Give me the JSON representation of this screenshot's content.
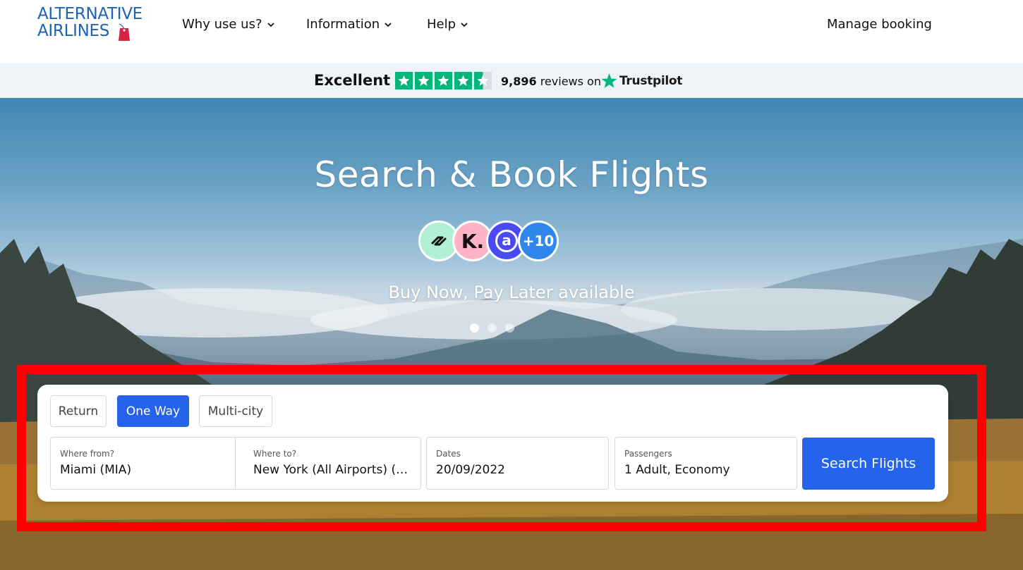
{
  "header": {
    "logo_line1": "ALTERNATIVE",
    "logo_line2": "AIRLINES",
    "nav": [
      {
        "label": "Why use us?"
      },
      {
        "label": "Information"
      },
      {
        "label": "Help"
      }
    ],
    "manage_booking": "Manage booking"
  },
  "trustpilot": {
    "rating_word": "Excellent",
    "stars": 4.5,
    "reviews_count": "9,896",
    "reviews_text": "reviews on",
    "brand": "Trustpilot",
    "star_color": "#00b67a"
  },
  "hero": {
    "title": "Search & Book Flights",
    "bnpl_more": "+10",
    "bnpl_klarna": "K.",
    "bnpl_atome": "a",
    "subtitle": "Buy Now, Pay Later available",
    "carousel_total": 3,
    "carousel_active": 1
  },
  "search": {
    "trip_types": [
      "Return",
      "One Way",
      "Multi-city"
    ],
    "active_trip": "One Way",
    "from": {
      "label": "Where from?",
      "value": "Miami (MIA)"
    },
    "to": {
      "label": "Where to?",
      "value": "New York (All Airports) (…"
    },
    "dates": {
      "label": "Dates",
      "value": "20/09/2022"
    },
    "passengers": {
      "label": "Passengers",
      "value": "1 Adult, Economy"
    },
    "button": "Search Flights",
    "accent": "#2563eb"
  },
  "highlight_color": "#ff0000"
}
